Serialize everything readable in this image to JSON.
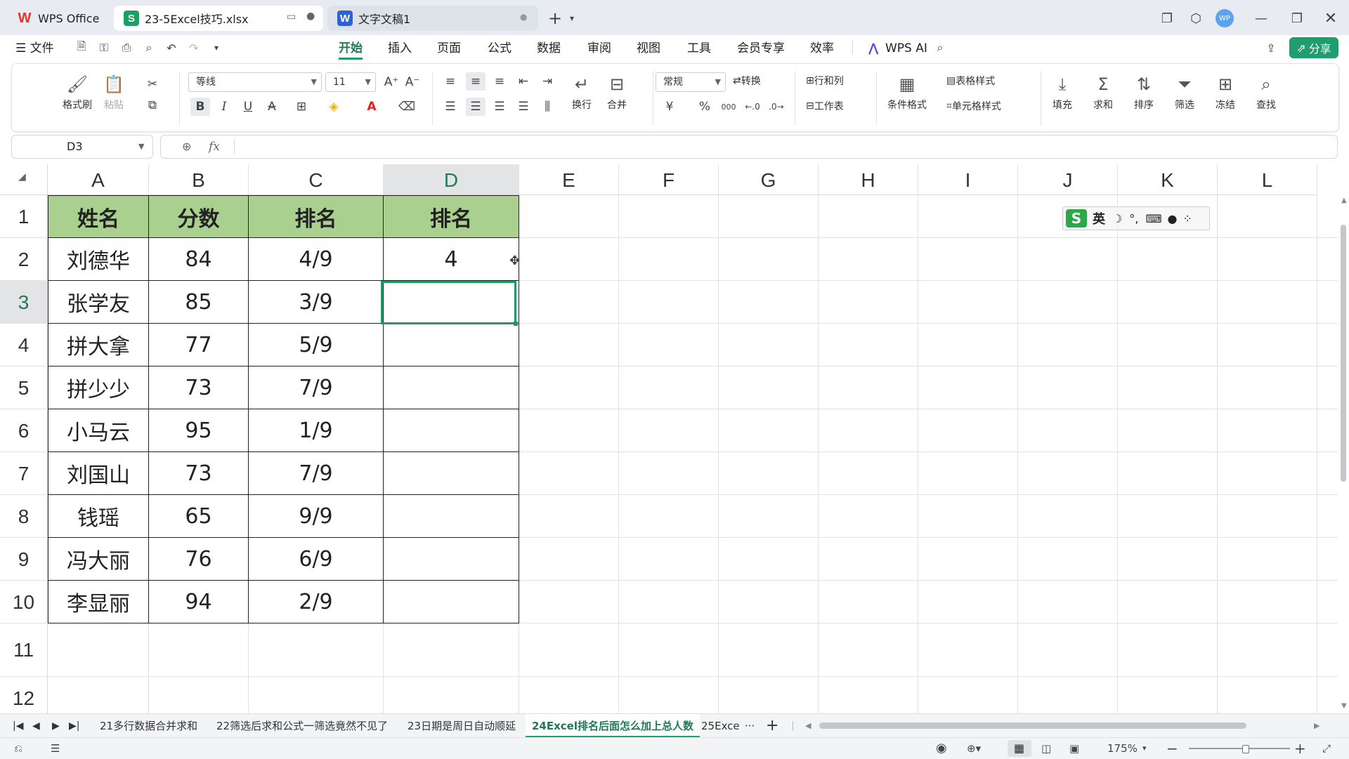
{
  "titlebar": {
    "tabs": [
      {
        "label": "WPS Office",
        "icon": "wps-logo-icon"
      },
      {
        "label": "23-5Excel技巧.xlsx",
        "icon": "spreadsheet-icon"
      },
      {
        "label": "文字文稿1",
        "icon": "writer-icon"
      }
    ],
    "avatar": "WP"
  },
  "menubar": {
    "file": "文件",
    "items": [
      "开始",
      "插入",
      "页面",
      "公式",
      "数据",
      "审阅",
      "视图",
      "工具",
      "会员专享",
      "效率"
    ],
    "active": "开始",
    "wps_ai": "WPS AI",
    "share": "分享"
  },
  "ribbon": {
    "format_painter": "格式刷",
    "paste": "粘贴",
    "font_name": "等线",
    "font_size": "11",
    "wrap": "换行",
    "merge": "合并",
    "number_format": "常规",
    "convert": "转换",
    "rows_cols": "行和列",
    "worksheet": "工作表",
    "cond_format": "条件格式",
    "table_style": "表格样式",
    "cell_style": "单元格样式",
    "fill": "填充",
    "sum": "求和",
    "sort": "排序",
    "filter": "筛选",
    "freeze": "冻结",
    "find": "查找",
    "currency": "¥",
    "percent": "%",
    "thousands": "000"
  },
  "formula": {
    "cell_ref": "D3",
    "fx": "fx",
    "content": ""
  },
  "sheet": {
    "columns": [
      "A",
      "B",
      "C",
      "D",
      "E",
      "F",
      "G",
      "H",
      "I",
      "J",
      "K",
      "L"
    ],
    "rows": [
      "1",
      "2",
      "3",
      "4",
      "5",
      "6",
      "7",
      "8",
      "9",
      "10",
      "11",
      "12"
    ],
    "header": [
      "姓名",
      "分数",
      "排名",
      "排名"
    ],
    "data": [
      [
        "刘德华",
        "84",
        "4/9",
        "4"
      ],
      [
        "张学友",
        "85",
        "3/9",
        ""
      ],
      [
        "拼大拿",
        "77",
        "5/9",
        ""
      ],
      [
        "拼少少",
        "73",
        "7/9",
        ""
      ],
      [
        "小马云",
        "95",
        "1/9",
        ""
      ],
      [
        "刘国山",
        "73",
        "7/9",
        ""
      ],
      [
        "钱瑶",
        "65",
        "9/9",
        ""
      ],
      [
        "冯大丽",
        "76",
        "6/9",
        ""
      ],
      [
        "李显丽",
        "94",
        "2/9",
        ""
      ]
    ],
    "selected_cell": "D3",
    "ime_label": "英"
  },
  "sheet_tabs": {
    "tabs": [
      "21多行数据合并求和",
      "22筛选后求和公式一筛选竟然不见了",
      "23日期是周日自动顺延",
      "24Excel排名后面怎么加上总人数",
      "25Exce"
    ],
    "active": "24Excel排名后面怎么加上总人数",
    "more": "···",
    "add": "+"
  },
  "statusbar": {
    "zoom": "175%"
  },
  "colors": {
    "header_fill": "#a9d08e",
    "accent": "#1e9a62",
    "active_tab": "#1f7a55",
    "share_btn": "#1f9d6f"
  }
}
